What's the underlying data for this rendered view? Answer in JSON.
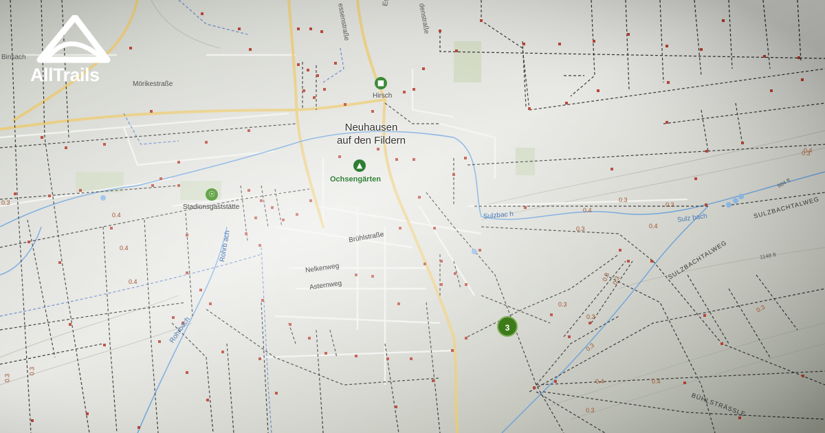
{
  "brand": {
    "name": "AllTrails",
    "logo_icon": "mountain-icon"
  },
  "map": {
    "town": {
      "line1": "Neuhausen",
      "line2": "auf den Fildern"
    },
    "pois": {
      "hirsch": "Hirsch",
      "ochsengarten": "Ochsengärten",
      "stadion": "Stadionsgaststätte"
    },
    "streets": {
      "binsach": "Binsach",
      "moerike": "Mörikestraße",
      "esslinger": "Esslinger Straße",
      "strasse_top": "essenstraße",
      "strasse_top2": "denstraße",
      "bruehl": "Brühlstraße",
      "nelken": "Nelkenweg",
      "aster": "Asternweg",
      "rohrbach1": "Rohrb ach",
      "rohrbach2": "Rohrbach",
      "sulzbach1": "Sulzbac h",
      "sulzbach2": "Sulz bach",
      "sulzbachtal1": "SULZBACHTALWEG",
      "sulzbachtal2": "SULZBACHTALWEG",
      "buehl": "BÜHLSTRÄSSLE",
      "elev1": "984 ft",
      "elev2": "1148 ft"
    },
    "distances": [
      "0.3",
      "0.4",
      "0.4",
      "0.4",
      "0.3",
      "0.4",
      "0.3",
      "0.4",
      "0.3",
      "0.3",
      "0.3",
      "0.3",
      "0.3",
      "0.3",
      "0.3",
      "0.3",
      "0.4",
      "0.4",
      "0.3",
      "0.4",
      "0.3",
      "0.3"
    ],
    "cluster_count": "3",
    "colors": {
      "trail_dots": "#b03020",
      "water": "#4a90d9",
      "main_road": "#e8c66a",
      "park": "#2e7d32",
      "cluster": "#3d7a1a"
    }
  }
}
